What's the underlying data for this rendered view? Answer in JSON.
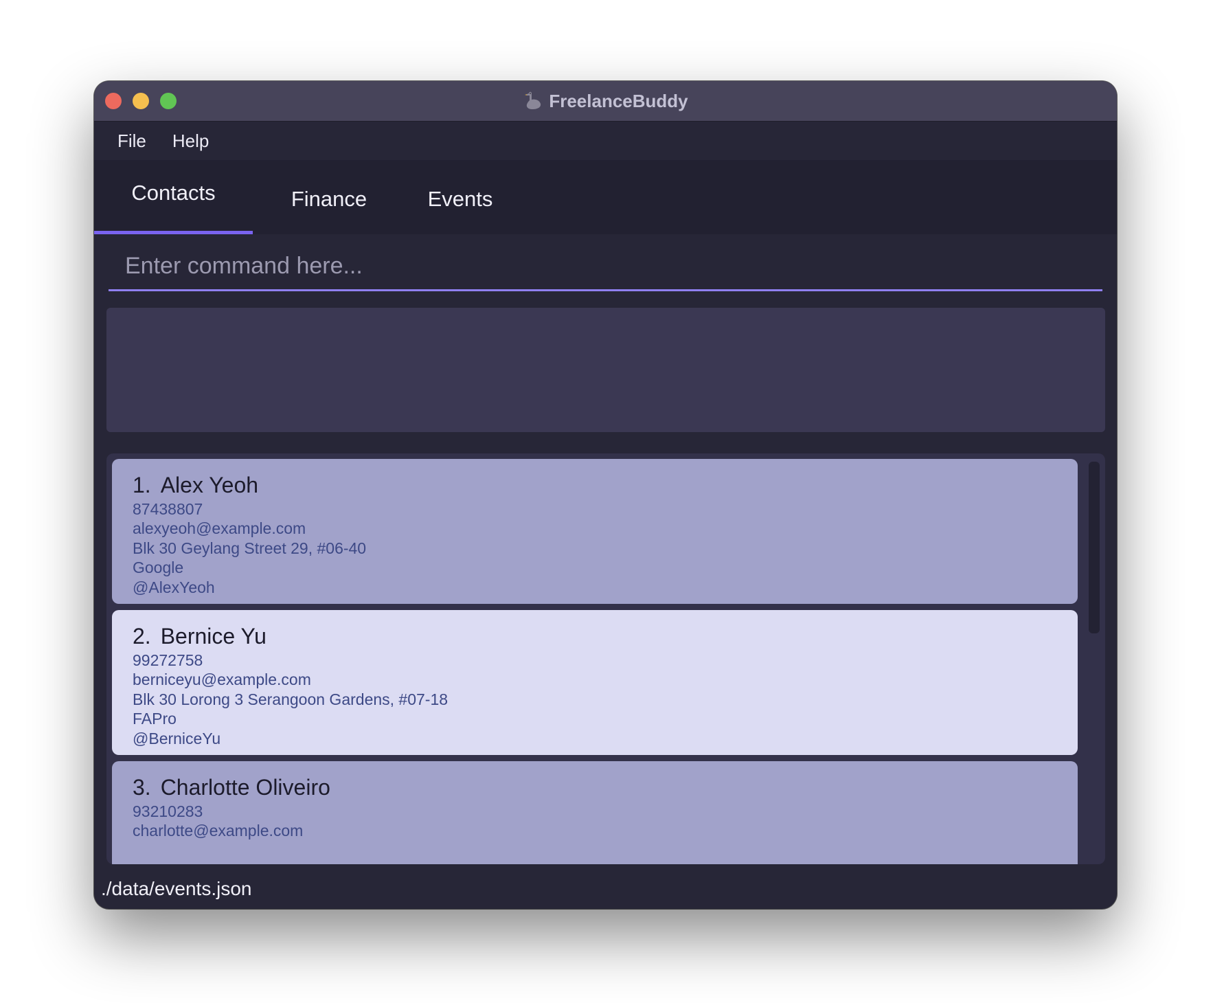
{
  "window": {
    "title": "FreelanceBuddy",
    "title_icon": "goose-icon"
  },
  "menu": {
    "file": "File",
    "help": "Help"
  },
  "tabs": [
    {
      "label": "Contacts",
      "active": true
    },
    {
      "label": "Finance",
      "active": false
    },
    {
      "label": "Events",
      "active": false
    }
  ],
  "command": {
    "placeholder": "Enter command here...",
    "value": ""
  },
  "result": {
    "text": ""
  },
  "contacts": [
    {
      "index": "1.",
      "name": "Alex Yeoh",
      "phone": "87438807",
      "email": "alexyeoh@example.com",
      "address": "Blk 30 Geylang Street 29, #06-40",
      "company": "Google",
      "telegram": "@AlexYeoh"
    },
    {
      "index": "2.",
      "name": "Bernice Yu",
      "phone": "99272758",
      "email": "berniceyu@example.com",
      "address": "Blk 30 Lorong 3 Serangoon Gardens, #07-18",
      "company": "FAPro",
      "telegram": "@BerniceYu"
    },
    {
      "index": "3.",
      "name": "Charlotte Oliveiro",
      "phone": "93210283",
      "email": "charlotte@example.com",
      "address": "",
      "company": "",
      "telegram": ""
    }
  ],
  "status": {
    "path": "./data/events.json"
  },
  "colors": {
    "accent": "#7a63f0",
    "card_odd": "#a1a2ca",
    "card_even": "#dcdcf3",
    "window_bg": "#272637"
  }
}
